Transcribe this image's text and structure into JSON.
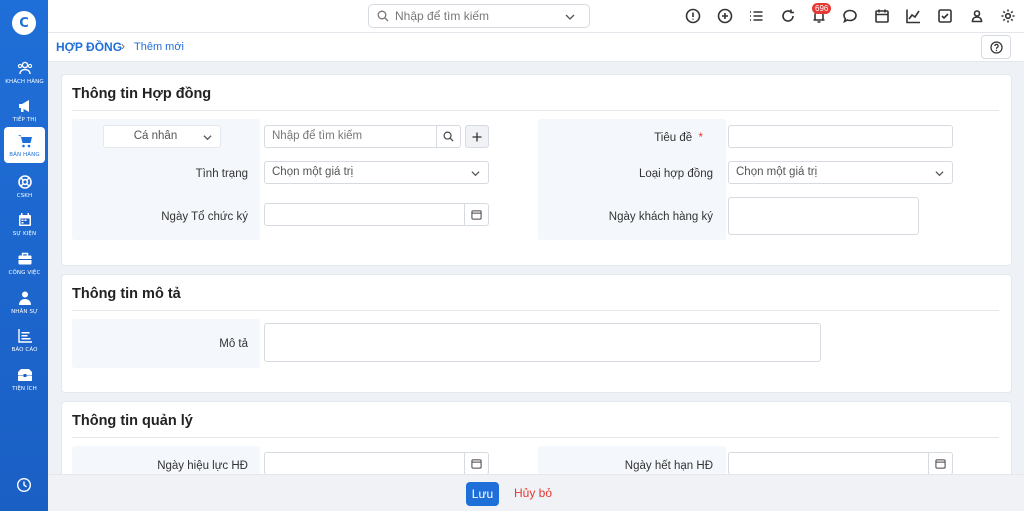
{
  "sidebar": {
    "items": [
      {
        "label": "KHÁCH HÀNG",
        "icon": "users-icon"
      },
      {
        "label": "TIẾP THỊ",
        "icon": "megaphone-icon"
      },
      {
        "label": "BÁN HÀNG",
        "icon": "cart-icon"
      },
      {
        "label": "CSKH",
        "icon": "support-icon"
      },
      {
        "label": "SỰ KIỆN",
        "icon": "calendar-icon"
      },
      {
        "label": "CÔNG VIỆC",
        "icon": "briefcase-icon"
      },
      {
        "label": "NHÂN SỰ",
        "icon": "person-icon"
      },
      {
        "label": "BÁO CÁO",
        "icon": "report-icon"
      },
      {
        "label": "TIỆN ÍCH",
        "icon": "toolbox-icon"
      }
    ],
    "active_index": 2
  },
  "topbar": {
    "search_placeholder": "Nhập để tìm kiếm",
    "notification_count": "696"
  },
  "breadcrumb": {
    "section": "HỢP ĐỒNG",
    "current": "Thêm mới"
  },
  "contract_info": {
    "title": "Thông tin Hợp đồng",
    "customer_type": "Cá nhân",
    "customer_search_placeholder": "Nhập để tìm kiếm",
    "status_label": "Tình trạng",
    "status_value": "Chọn một giá trị",
    "org_date_label": "Ngày Tổ chức ký",
    "title_label": "Tiêu đề",
    "required_mark": "*",
    "contract_type_label": "Loại hợp đồng",
    "contract_type_value": "Chọn một giá trị",
    "customer_sign_date_label": "Ngày khách hàng ký"
  },
  "description_info": {
    "title": "Thông tin mô tả",
    "desc_label": "Mô tả"
  },
  "management_info": {
    "title": "Thông tin quản lý",
    "effective_date_label": "Ngày hiệu lực HĐ",
    "expiry_date_label": "Ngày hết hạn HĐ"
  },
  "footer": {
    "save_label": "Lưu",
    "cancel_label": "Hủy bỏ"
  },
  "colors": {
    "primary": "#1f6fd8",
    "danger": "#e53935"
  }
}
